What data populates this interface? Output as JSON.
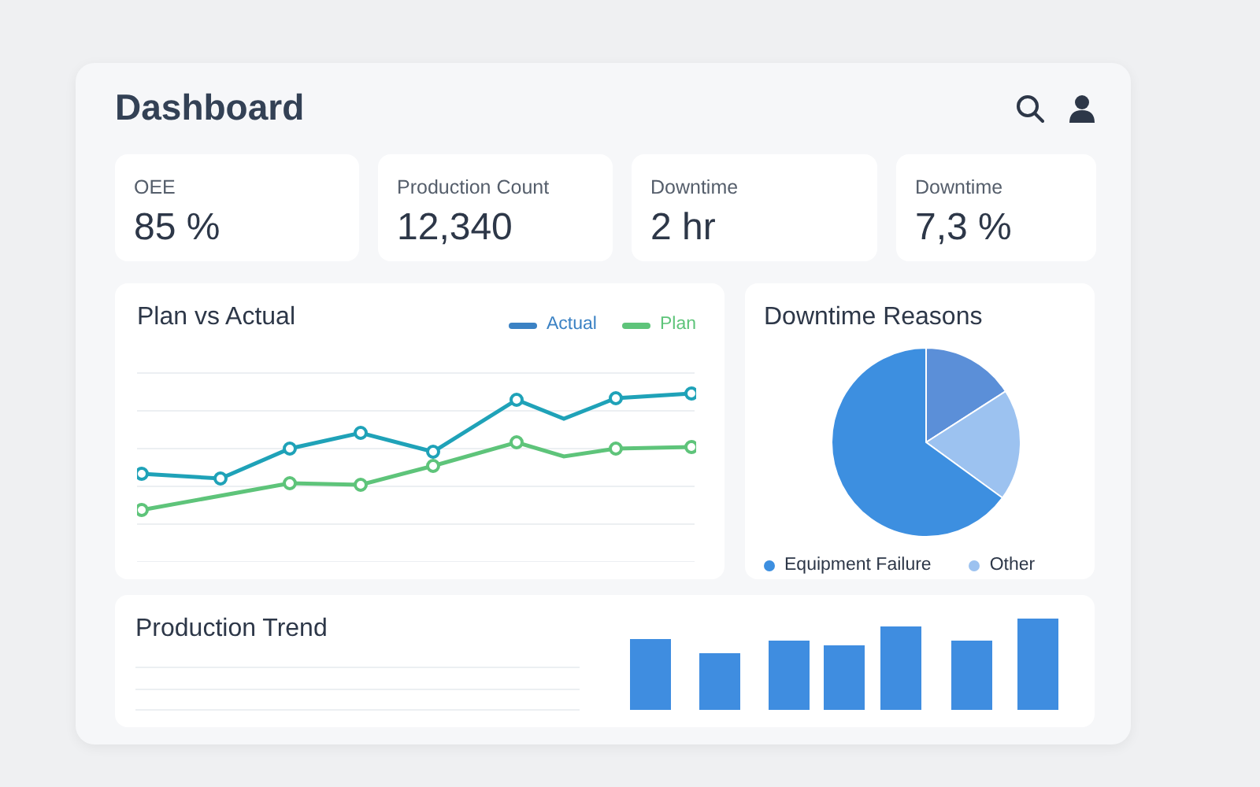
{
  "header": {
    "title": "Dashboard"
  },
  "kpis": [
    {
      "label": "OEE",
      "value": "85 %"
    },
    {
      "label": "Production Count",
      "value": "12,340"
    },
    {
      "label": "Downtime",
      "value": "2 hr"
    },
    {
      "label": "Downtime",
      "value": "7,3 %"
    }
  ],
  "plan_vs_actual": {
    "title": "Plan vs Actual",
    "legend": [
      {
        "label": "Actual",
        "color": "#3b82c4"
      },
      {
        "label": "Plan",
        "color": "#5ec47a"
      }
    ]
  },
  "downtime_reasons": {
    "title": "Downtime Reasons",
    "legend": [
      {
        "label": "Equipment Failure",
        "color": "#3d8fe0"
      },
      {
        "label": "Other",
        "color": "#9cc2f0"
      }
    ]
  },
  "production_trend": {
    "title": "Production Trend"
  }
}
